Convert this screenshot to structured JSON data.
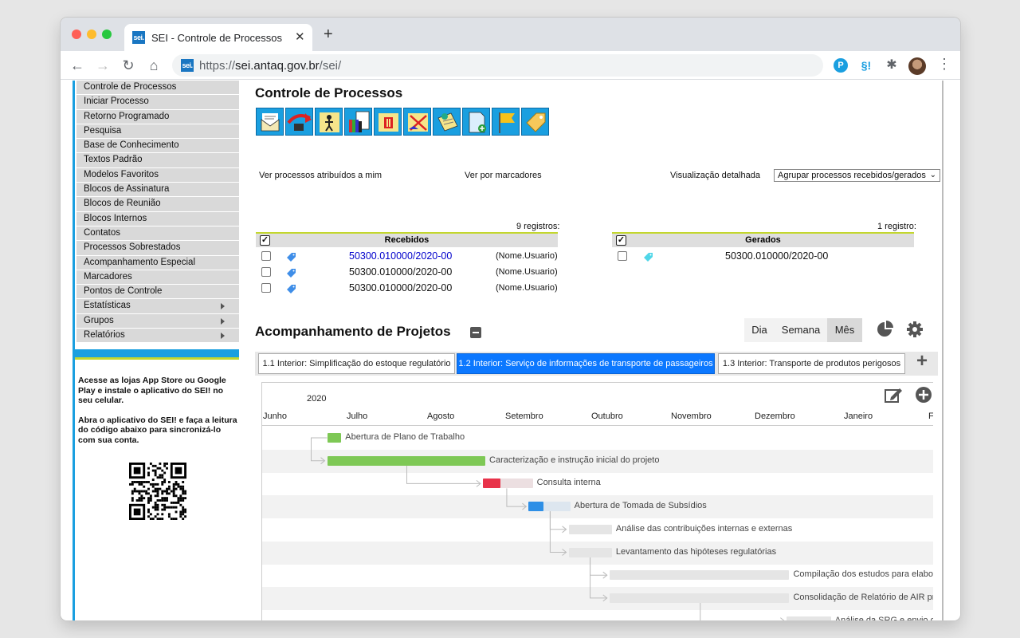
{
  "browser": {
    "tab_title": "SEI - Controle de Processos",
    "favicon_text": "sei.",
    "url_prefix": "https://",
    "url_host": "sei.antaq.gov.br",
    "url_path": "/sei/",
    "extensions": [
      "P",
      "§!"
    ]
  },
  "sidebar": {
    "items": [
      {
        "label": "Controle de Processos"
      },
      {
        "label": "Iniciar Processo"
      },
      {
        "label": "Retorno Programado"
      },
      {
        "label": "Pesquisa"
      },
      {
        "label": "Base de Conhecimento"
      },
      {
        "label": "Textos Padrão"
      },
      {
        "label": "Modelos Favoritos"
      },
      {
        "label": "Blocos de Assinatura"
      },
      {
        "label": "Blocos de Reunião"
      },
      {
        "label": "Blocos Internos"
      },
      {
        "label": "Contatos"
      },
      {
        "label": "Processos Sobrestados"
      },
      {
        "label": "Acompanhamento Especial"
      },
      {
        "label": "Marcadores"
      },
      {
        "label": "Pontos de Controle"
      },
      {
        "label": "Estatísticas",
        "submenu": true
      },
      {
        "label": "Grupos",
        "submenu": true
      },
      {
        "label": "Relatórios",
        "submenu": true
      }
    ],
    "app_text_1": "Acesse as lojas App Store ou Google Play e instale o aplicativo do SEI! no seu celular.",
    "app_text_2": "Abra o aplicativo do SEI! e faça a leitura do código abaixo para sincronizá-lo com sua conta."
  },
  "main": {
    "title": "Controle de Processos",
    "link_atribuidos": "Ver processos atribuídos a mim",
    "link_marcadores": "Ver por marcadores",
    "link_detalhada": "Visualização detalhada",
    "group_select": "Agrupar processos recebidos/gerados",
    "recebidos": {
      "count": "9 registros:",
      "header": "Recebidos",
      "rows": [
        {
          "process": "50300.010000/2020-00",
          "user": "(Nome.Usuario)"
        },
        {
          "process": "50300.010000/2020-00",
          "user": "(Nome.Usuario)"
        },
        {
          "process": "50300.010000/2020-00",
          "user": "(Nome.Usuario)"
        }
      ]
    },
    "gerados": {
      "count": "1 registro:",
      "header": "Gerados",
      "rows": [
        {
          "process": "50300.010000/2020-00"
        }
      ]
    }
  },
  "projects": {
    "title": "Acompanhamento de Projetos",
    "views": [
      "Dia",
      "Semana",
      "Mês"
    ],
    "active_view": "Mês",
    "tabs": [
      "1.1 Interior: Simplificação do estoque regulatório",
      "1.2 Interior: Serviço de informações de transporte de passageiros",
      "1.3 Interior: Transporte de produtos perigosos"
    ],
    "active_tab": 1
  },
  "chart_data": {
    "type": "gantt",
    "year": "2020",
    "months": [
      "Junho",
      "Julho",
      "Agosto",
      "Setembro",
      "Outubro",
      "Novembro",
      "Dezembro",
      "Janeiro",
      "Fe"
    ],
    "tasks": [
      {
        "name": "Abertura de Plano de Trabalho",
        "start": 0.78,
        "end": 0.95,
        "progress": 1.0,
        "color": "#7ec855"
      },
      {
        "name": "Caracterização e instrução inicial do projeto",
        "start": 0.78,
        "end": 2.68,
        "progress": 1.0,
        "color": "#7ec855"
      },
      {
        "name": "Consulta interna",
        "start": 2.65,
        "end": 3.25,
        "progress": 0.35,
        "color": "#e8334a"
      },
      {
        "name": "Abertura de Tomada de Subsídios",
        "start": 3.2,
        "end": 3.7,
        "progress": 0.35,
        "color": "#2e8fe6"
      },
      {
        "name": "Análise das contribuições internas e externas",
        "start": 3.68,
        "end": 4.2,
        "progress": 0,
        "color": "#e5e5e5"
      },
      {
        "name": "Levantamento das hipóteses regulatórias",
        "start": 3.68,
        "end": 4.2,
        "progress": 0,
        "color": "#e5e5e5"
      },
      {
        "name": "Compilação dos estudos para elabora",
        "start": 4.17,
        "end": 6.33,
        "progress": 0,
        "color": "#e5e5e5"
      },
      {
        "name": "Consolidação de Relatório de AIR pre",
        "start": 4.17,
        "end": 6.33,
        "progress": 0,
        "color": "#e5e5e5"
      },
      {
        "name": "Análise da SRG e envio de",
        "start": 6.3,
        "end": 6.83,
        "progress": 0,
        "color": "#e5e5e5"
      }
    ],
    "dependencies": [
      [
        0,
        1
      ],
      [
        1,
        2
      ],
      [
        2,
        3
      ],
      [
        3,
        4
      ],
      [
        3,
        5
      ],
      [
        5,
        6
      ],
      [
        5,
        7
      ],
      [
        7,
        8
      ]
    ]
  }
}
